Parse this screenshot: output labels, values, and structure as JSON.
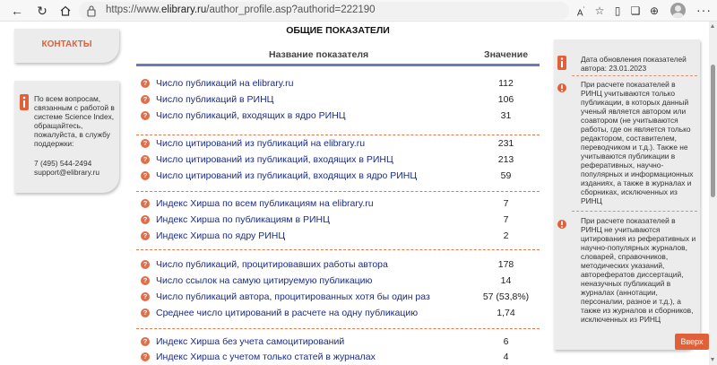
{
  "browser": {
    "url_prefix": "https://www.",
    "url_domain": "elibrary.ru",
    "url_path": "/author_profile.asp?authorid=222190",
    "icons": [
      "back-icon",
      "refresh-icon",
      "home-icon",
      "lock-icon",
      "read-aloud-icon",
      "favorite-icon",
      "split-screen-icon",
      "collections-icon",
      "downloads-icon",
      "profile-icon",
      "more-icon"
    ]
  },
  "left": {
    "contacts_label": "КОНТАКТЫ",
    "support_text": "По всем вопросам, связанным с работой в системе Science Index, обращайтесь, пожалуйста, в службу поддержки:",
    "phone": "7 (495) 544-2494",
    "email": "support@elibrary.ru"
  },
  "main": {
    "heading": "ОБЩИЕ ПОКАЗАТЕЛИ",
    "col_name": "Название показателя",
    "col_value": "Значение",
    "rows": [
      {
        "label": "Число публикаций на elibrary.ru",
        "value": "112"
      },
      {
        "label": "Число публикаций в РИНЦ",
        "value": "106"
      },
      {
        "label": "Число публикаций, входящих в ядро РИНЦ",
        "value": "31"
      },
      {
        "label": "Число цитирований из публикаций на elibrary.ru",
        "value": "231"
      },
      {
        "label": "Число цитирований из публикаций, входящих в РИНЦ",
        "value": "213"
      },
      {
        "label": "Число цитирований из публикаций, входящих в ядро РИНЦ",
        "value": "59"
      },
      {
        "label": "Индекс Хирша по всем публикациям на elibrary.ru",
        "value": "7"
      },
      {
        "label": "Индекс Хирша по публикациям в РИНЦ",
        "value": "7"
      },
      {
        "label": "Индекс Хирша по ядру РИНЦ",
        "value": "2"
      },
      {
        "label": "Число публикаций, процитировавших работы автора",
        "value": "178"
      },
      {
        "label": "Число ссылок на самую цитируемую публикацию",
        "value": "14"
      },
      {
        "label": "Число публикаций автора, процитированных хотя бы один раз",
        "value": "57 (53,8%)"
      },
      {
        "label": "Среднее число цитирований в расчете на одну публикацию",
        "value": "1,74"
      },
      {
        "label": "Индекс Хирша без учета самоцитирований",
        "value": "6"
      },
      {
        "label": "Индекс Хирша с учетом только статей в журналах",
        "value": "4"
      }
    ],
    "help_glyph": "?"
  },
  "right": {
    "items": [
      "Дата обновления показателей автора: 23.01.2023",
      "При расчете показателей в РИНЦ учитываются только публикации, в которых данный ученый является автором или соавтором (не учитываются работы, где он является только редактором, составителем, переводчиком и т.д.). Также не учитываются публикации в реферативных, научно-популярных и информационных изданиях, а также в журналах и сборниках, исключенных из РИНЦ",
      "При расчете показателей в РИНЦ не учитываются цитирования из реферативных и научно-популярных журналов, словарей, справочников, методических указаний, авторефератов диссертаций, неназучных публикаций в журналах (аннотации, персоналии, разное и т.д.), а также из журналов и сборников, исключенных из РИНЦ"
    ],
    "up_button": "Вверх"
  },
  "colors": {
    "accent": "#e0603a",
    "link": "#1a2c8c",
    "header_line": "#6a7bb5"
  }
}
